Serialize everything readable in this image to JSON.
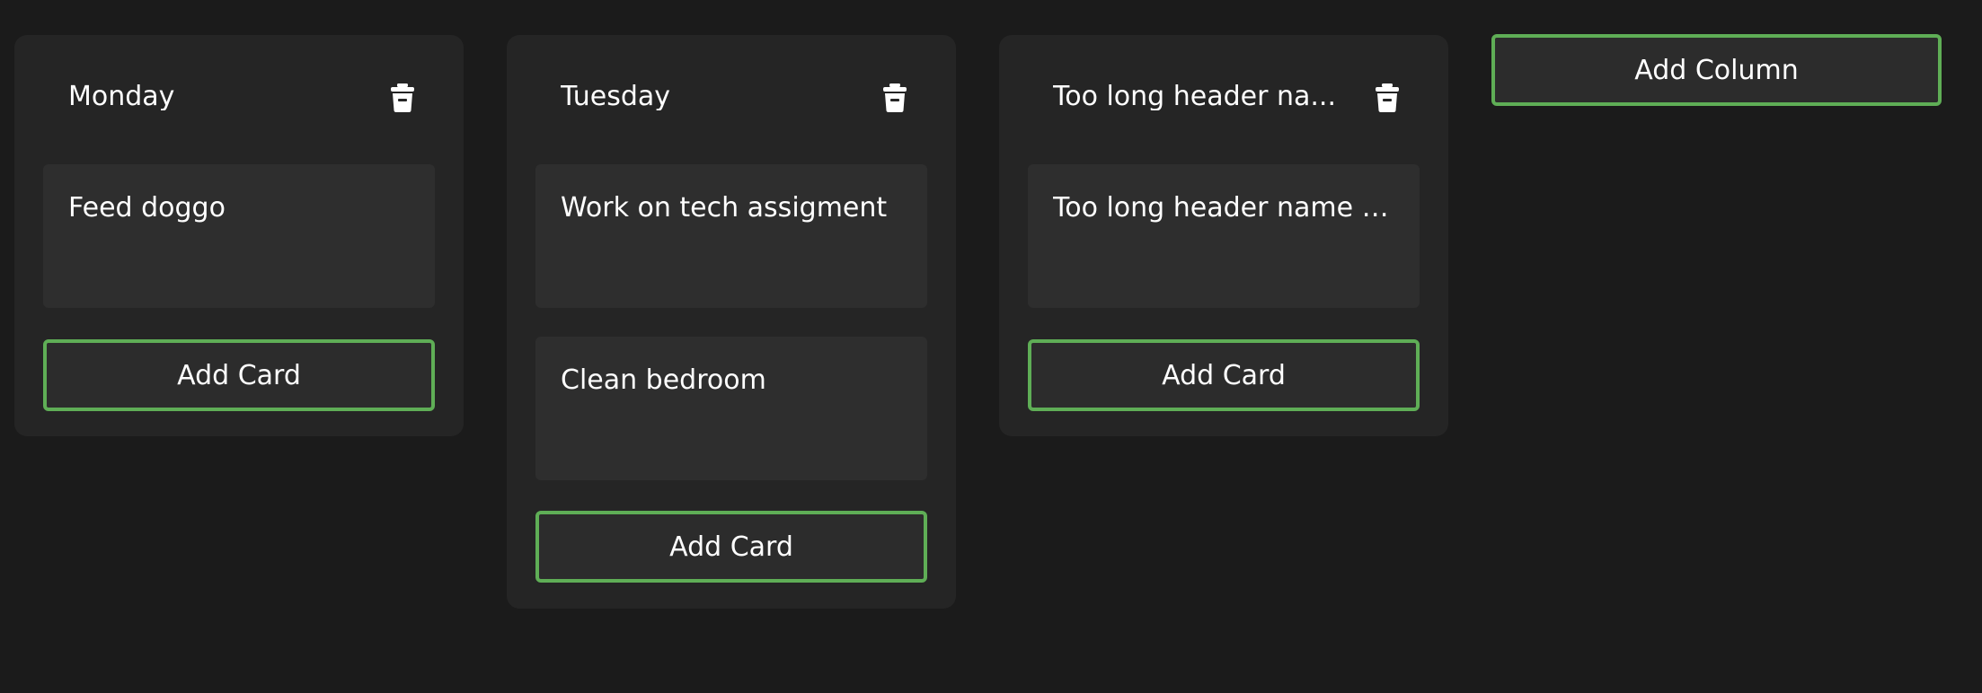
{
  "columns": [
    {
      "title": "Monday",
      "delete_icon": "trash-icon",
      "cards": [
        {
          "text": "Feed doggo"
        }
      ],
      "add_card_label": "Add Card"
    },
    {
      "title": "Tuesday",
      "delete_icon": "trash-icon",
      "cards": [
        {
          "text": "Work on tech assigment"
        },
        {
          "text": "Clean bedroom"
        }
      ],
      "add_card_label": "Add Card"
    },
    {
      "title": "Too long header na...",
      "delete_icon": "trash-icon",
      "cards": [
        {
          "text": "Too long header name T..."
        }
      ],
      "add_card_label": "Add Card"
    }
  ],
  "add_column_label": "Add Column",
  "colors": {
    "background": "#1b1b1b",
    "column": "#252525",
    "card": "#2e2e2e",
    "button_border": "#5fae56"
  }
}
